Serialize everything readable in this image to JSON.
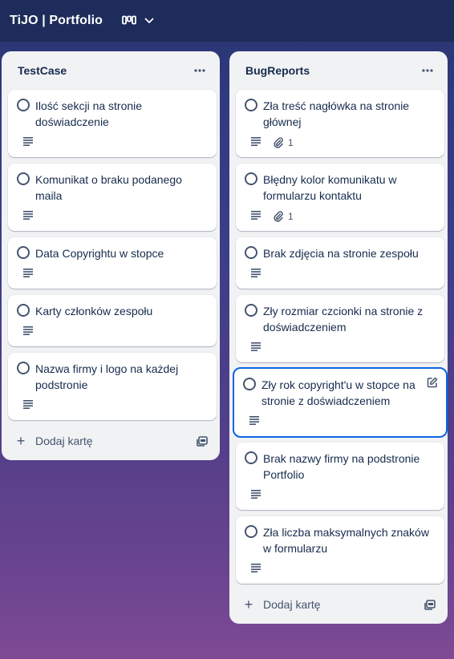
{
  "board": {
    "title": "TiJO | Portfolio",
    "view_icon": "board-view-icon",
    "dropdown_icon": "chevron-down-icon"
  },
  "colors": {
    "topbar": "#1d2c5a",
    "list_background": "#f1f2f4",
    "card_background": "#ffffff",
    "focus_outline": "#0c66e4",
    "text": "#172b4d",
    "subtle_text": "#44546f"
  },
  "lists": [
    {
      "title": "TestCase",
      "menu_icon": "more-horizontal-icon",
      "add_card_label": "Dodaj kartę",
      "cards": [
        {
          "title": "Ilość sekcji na stronie doświadczenie",
          "has_description": true
        },
        {
          "title": "Komunikat o braku podanego maila",
          "has_description": true
        },
        {
          "title": "Data Copyrightu w stopce",
          "has_description": true
        },
        {
          "title": "Karty członków zespołu",
          "has_description": true
        },
        {
          "title": "Nazwa firmy i logo na każdej podstronie",
          "has_description": true
        }
      ]
    },
    {
      "title": "BugReports",
      "menu_icon": "more-horizontal-icon",
      "add_card_label": "Dodaj kartę",
      "cards": [
        {
          "title": "Zła treść nagłówka na stronie głównej",
          "has_description": true,
          "attachments": "1"
        },
        {
          "title": "Błędny kolor komunikatu w formularzu kontaktu",
          "has_description": true,
          "attachments": "1"
        },
        {
          "title": "Brak zdjęcia na stronie zespołu",
          "has_description": true
        },
        {
          "title": "Zły rozmiar czcionki na stronie z doświadczeniem",
          "has_description": true
        },
        {
          "title": "Zły rok copyright'u w stopce na stronie z doświadczeniem",
          "has_description": true,
          "focused": true,
          "edit_icon": "edit-pencil-icon"
        },
        {
          "title": "Brak nazwy firmy na podstronie Portfolio",
          "has_description": true
        },
        {
          "title": "Zła liczba maksymalnych znaków w formularzu",
          "has_description": true
        }
      ]
    }
  ]
}
